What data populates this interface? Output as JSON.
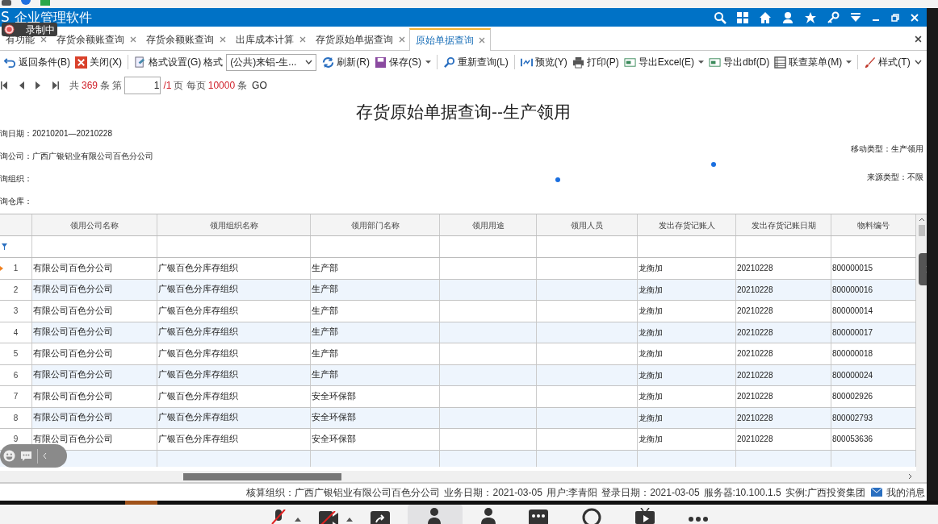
{
  "window": {
    "logo": "S",
    "title": "企业管理软件",
    "recording": "录制中"
  },
  "tabs": [
    {
      "label": "有功能",
      "selected": false
    },
    {
      "label": "存货余额账查询",
      "selected": false
    },
    {
      "label": "存货余额账查询",
      "selected": false
    },
    {
      "label": "出库成本计算",
      "selected": false
    },
    {
      "label": "存货原始单据查询",
      "selected": false
    },
    {
      "label": "原始单据查询",
      "selected": true
    }
  ],
  "toolbar": [
    {
      "kind": "button",
      "label": "返回条件(B)",
      "dropdown": false
    },
    {
      "kind": "button",
      "label": "关闭(X)",
      "dropdown": false
    },
    {
      "kind": "separator"
    },
    {
      "kind": "button",
      "label": "格式设置(G)",
      "dropdown": false
    },
    {
      "kind": "label",
      "label": "格式"
    },
    {
      "kind": "select",
      "value": "(公共)来铝-生..."
    },
    {
      "kind": "button",
      "label": "刷新(R)",
      "dropdown": false
    },
    {
      "kind": "button",
      "label": "保存(S)",
      "dropdown": true
    },
    {
      "kind": "separator"
    },
    {
      "kind": "button",
      "label": "重新查询(L)",
      "dropdown": false
    },
    {
      "kind": "separator"
    },
    {
      "kind": "button",
      "label": "预览(Y)",
      "dropdown": false
    },
    {
      "kind": "button",
      "label": "打印(P)",
      "dropdown": false
    },
    {
      "kind": "button",
      "label": "导出Excel(E)",
      "dropdown": true
    },
    {
      "kind": "button",
      "label": "导出dbf(D)",
      "dropdown": false
    },
    {
      "kind": "button",
      "label": "联查菜单(M)",
      "dropdown": true
    },
    {
      "kind": "separator"
    },
    {
      "kind": "button",
      "label": "样式(T)",
      "dropdown": false
    }
  ],
  "pager": [
    {
      "kind": "text",
      "text": "共"
    },
    {
      "kind": "number",
      "text": "369"
    },
    {
      "kind": "text",
      "text": "条 第"
    },
    {
      "kind": "input",
      "text": "1"
    },
    {
      "kind": "number",
      "text": "/1"
    },
    {
      "kind": "text",
      "text": "页 每页"
    },
    {
      "kind": "number",
      "text": "10000"
    },
    {
      "kind": "text",
      "text": "条"
    },
    {
      "kind": "button",
      "text": "GO"
    }
  ],
  "report_title": "存货原始单据查询--生产领用",
  "info_left": [
    "询日期：20210201—20210228",
    "询公司：广西广银铝业有限公司百色分公司",
    "询组织：",
    "询仓库："
  ],
  "info_right": [
    "移动类型：生产领用",
    "来源类型：不限"
  ],
  "table": {
    "columns": [
      "领用公司名称",
      "领用组织名称",
      "领用部门名称",
      "领用用途",
      "领用人员",
      "发出存货记账人",
      "发出存货记账日期",
      "物料编号"
    ],
    "rows": [
      {
        "num": "1",
        "current": true,
        "cells": [
          "有限公司百色分公司",
          "广银百色分库存组织",
          "生产部",
          "",
          "",
          "龙衡加",
          "20210228",
          "800000015"
        ]
      },
      {
        "num": "2",
        "current": false,
        "cells": [
          "有限公司百色分公司",
          "广银百色分库存组织",
          "生产部",
          "",
          "",
          "龙衡加",
          "20210228",
          "800000016"
        ]
      },
      {
        "num": "3",
        "current": false,
        "cells": [
          "有限公司百色分公司",
          "广银百色分库存组织",
          "生产部",
          "",
          "",
          "龙衡加",
          "20210228",
          "800000014"
        ]
      },
      {
        "num": "4",
        "current": false,
        "cells": [
          "有限公司百色分公司",
          "广银百色分库存组织",
          "生产部",
          "",
          "",
          "龙衡加",
          "20210228",
          "800000017"
        ]
      },
      {
        "num": "5",
        "current": false,
        "cells": [
          "有限公司百色分公司",
          "广银百色分库存组织",
          "生产部",
          "",
          "",
          "龙衡加",
          "20210228",
          "800000018"
        ]
      },
      {
        "num": "6",
        "current": false,
        "cells": [
          "有限公司百色分公司",
          "广银百色分库存组织",
          "生产部",
          "",
          "",
          "龙衡加",
          "20210228",
          "800000024"
        ]
      },
      {
        "num": "7",
        "current": false,
        "cells": [
          "有限公司百色分公司",
          "广银百色分库存组织",
          "安全环保部",
          "",
          "",
          "龙衡加",
          "20210228",
          "800002926"
        ]
      },
      {
        "num": "8",
        "current": false,
        "cells": [
          "有限公司百色分公司",
          "广银百色分库存组织",
          "安全环保部",
          "",
          "",
          "龙衡加",
          "20210228",
          "800002793"
        ]
      },
      {
        "num": "9",
        "current": false,
        "cells": [
          "有限公司百色分公司",
          "广银百色分库存组织",
          "安全环保部",
          "",
          "",
          "龙衡加",
          "20210228",
          "800053636"
        ]
      }
    ]
  },
  "status_bar": [
    "核算组织：广西广银铝业有限公司百色分公司",
    "业务日期：2021-03-05",
    "用户:李青阳",
    "登录日期：2021-03-05",
    "服务器:10.100.1.5",
    "实例:广西投资集团"
  ],
  "messages": "我的消息"
}
